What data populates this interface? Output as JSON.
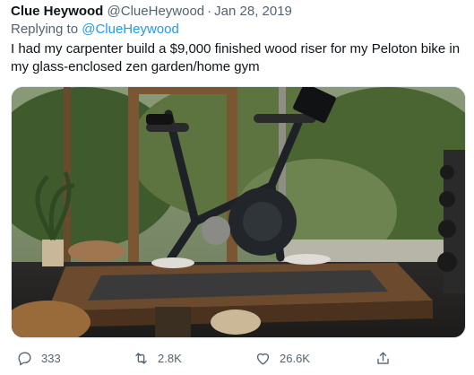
{
  "tweet": {
    "author_name": "Clue Heywood",
    "handle": "@ClueHeywood",
    "separator": "·",
    "date": "Jan 28, 2019",
    "reply_prefix": "Replying to",
    "reply_to": "@ClueHeywood",
    "text": "I had my carpenter build a $9,000 finished wood riser for my Peloton bike in my glass-enclosed zen garden/home gym"
  },
  "actions": {
    "reply_count": "333",
    "retweet_count": "2.8K",
    "like_count": "26.6K"
  },
  "icons": {
    "reply": "speech-bubble-icon",
    "retweet": "retweet-arrows-icon",
    "like": "heart-icon",
    "share": "share-upload-icon"
  },
  "colors": {
    "text": "#0f1419",
    "secondary": "#536471",
    "link": "#1d9bf0"
  }
}
